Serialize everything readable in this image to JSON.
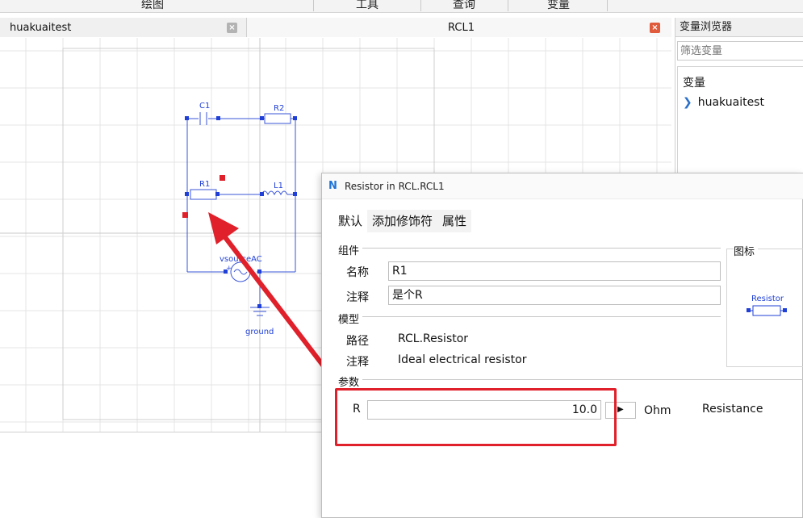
{
  "menubar": {
    "items": [
      "绘图",
      "工具",
      "查询",
      "变量"
    ]
  },
  "tabs": [
    {
      "label": "huakuaitest",
      "close": "×"
    },
    {
      "label": "RCL1",
      "close": "×"
    }
  ],
  "diagram": {
    "labels": {
      "c1": "C1",
      "r2": "R2",
      "r1": "R1",
      "l1": "L1",
      "vsource": "vsourceAC",
      "ground": "ground"
    }
  },
  "variable_browser": {
    "title": "变量浏览器",
    "filter_placeholder": "筛选变量",
    "header": "变量",
    "items": [
      {
        "label": "huakuaitest",
        "expand_icon": "chevron-right-icon"
      }
    ]
  },
  "dialog": {
    "title": "Resistor in RCL.RCL1",
    "logo": "N",
    "tabs": [
      "默认",
      "添加修饰符",
      "属性"
    ],
    "component_group": "组件",
    "name_label": "名称",
    "name_value": "R1",
    "comment_label": "注释",
    "comment_value": "是个R",
    "model_group": "模型",
    "path_label": "路径",
    "path_value": "RCL.Resistor",
    "model_comment_label": "注释",
    "model_comment_value": "Ideal electrical resistor",
    "icon_group": "图标",
    "icon_label": "Resistor",
    "params_group": "参数",
    "param": {
      "name": "R",
      "value": "10.0",
      "unit": "Ohm",
      "description": "Resistance"
    }
  },
  "colors": {
    "accent": "#1e73d8",
    "wire": "#3a55d8",
    "highlight": "#e0202a",
    "close_red": "#e05a3c",
    "close_gray": "#b3b3b3"
  }
}
